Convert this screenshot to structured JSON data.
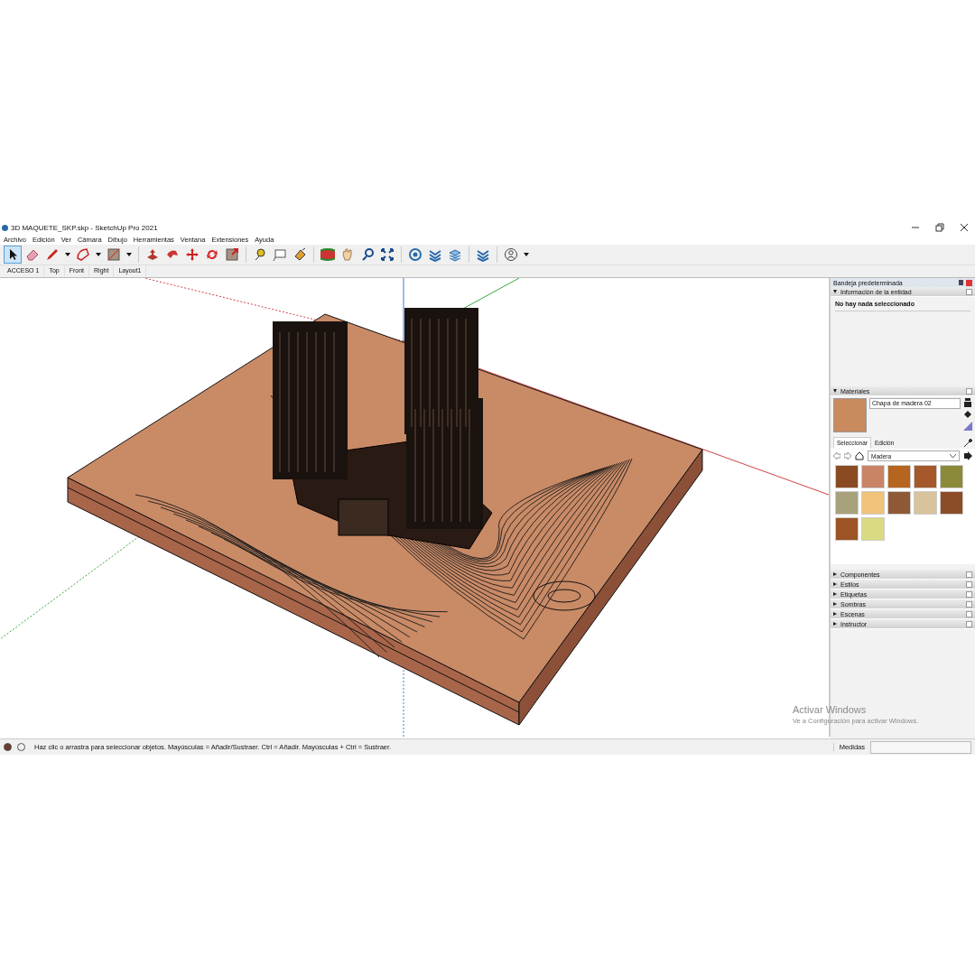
{
  "window": {
    "title": "3D MAQUETE_SKP.skp - SketchUp Pro 2021"
  },
  "menu": [
    "Archivo",
    "Edición",
    "Ver",
    "Cámara",
    "Dibujo",
    "Herramientas",
    "Ventana",
    "Extensiones",
    "Ayuda"
  ],
  "toolbar": [
    {
      "kind": "select",
      "selected": true
    },
    {
      "kind": "eraser",
      "selected": false
    },
    {
      "kind": "pencil",
      "selected": false
    },
    {
      "kind": "caret"
    },
    {
      "kind": "arc",
      "selected": false
    },
    {
      "kind": "caret"
    },
    {
      "kind": "rect",
      "selected": false
    },
    {
      "kind": "caret"
    },
    {
      "kind": "sep"
    },
    {
      "kind": "pushpull",
      "selected": false
    },
    {
      "kind": "followme",
      "selected": false
    },
    {
      "kind": "move",
      "selected": false
    },
    {
      "kind": "rotate",
      "selected": false
    },
    {
      "kind": "scale",
      "selected": false
    },
    {
      "kind": "sep"
    },
    {
      "kind": "tape",
      "selected": false
    },
    {
      "kind": "text",
      "selected": false
    },
    {
      "kind": "paint",
      "selected": false
    },
    {
      "kind": "sep"
    },
    {
      "kind": "orbit",
      "selected": false
    },
    {
      "kind": "pan",
      "selected": false
    },
    {
      "kind": "zoom",
      "selected": false
    },
    {
      "kind": "extents",
      "selected": false
    },
    {
      "kind": "sep"
    },
    {
      "kind": "warehouse",
      "selected": false
    },
    {
      "kind": "ext",
      "selected": false
    },
    {
      "kind": "layers",
      "selected": false
    },
    {
      "kind": "sep"
    },
    {
      "kind": "ext",
      "selected": false
    },
    {
      "kind": "sep"
    },
    {
      "kind": "user",
      "selected": false
    },
    {
      "kind": "caret"
    }
  ],
  "scenes": [
    "ACCESO 1",
    "Top",
    "Front",
    "Right",
    "Layout1"
  ],
  "tray": {
    "title": "Bandeja predeterminada",
    "entity_info": {
      "title": "Información de la entidad",
      "expanded": true,
      "message": "No hay nada seleccionado"
    },
    "materials": {
      "title": "Materiales",
      "expanded": true,
      "current": {
        "name": "Chapa de madera 02",
        "color": "#c98a5e"
      },
      "tabs": [
        {
          "label": "Seleccionar",
          "selected": true
        },
        {
          "label": "Edición",
          "selected": false
        }
      ],
      "library": "Madera",
      "swatches": [
        {
          "color": "#8a4a22"
        },
        {
          "color": "#c98466"
        },
        {
          "color": "#b5651e"
        },
        {
          "color": "#a5582a"
        },
        {
          "color": "#8b8a3a"
        },
        {
          "color": "#a8a27c"
        },
        {
          "color": "#f0c27a"
        },
        {
          "color": "#8e5a36"
        },
        {
          "color": "#d8c39c"
        },
        {
          "color": "#8c4c28"
        },
        {
          "color": "#9c5424"
        },
        {
          "color": "#dada82"
        }
      ]
    },
    "panels": [
      {
        "title": "Componentes",
        "expanded": false
      },
      {
        "title": "Estilos",
        "expanded": false
      },
      {
        "title": "Etiquetas",
        "expanded": false
      },
      {
        "title": "Sombras",
        "expanded": false
      },
      {
        "title": "Escenas",
        "expanded": false
      },
      {
        "title": "Instructor",
        "expanded": false
      }
    ]
  },
  "activation": {
    "title": "Activar Windows",
    "subtitle": "Ve a Configuración para activar Windows."
  },
  "status_bar": {
    "message": "Haz clic o arrastra para seleccionar objetos. Mayúsculas = Añadir/Sustraer. Ctrl = Añadir. Mayúsculas + Ctrl = Sustraer.",
    "measure_label": "Medidas"
  }
}
